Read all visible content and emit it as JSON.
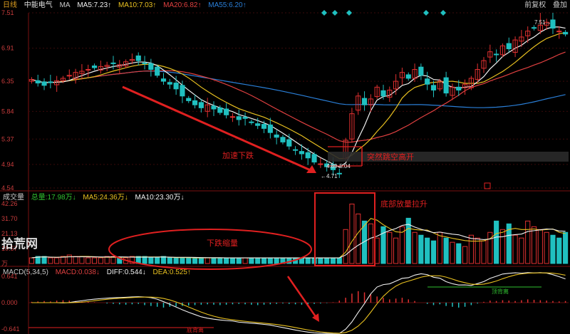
{
  "header": {
    "period": "日线",
    "stock": "中能电气",
    "ma_label": "MA",
    "ma5": "MA5:7.23↑",
    "ma10": "MA10:7.03↑",
    "ma20": "MA20:6.82↑",
    "ma55": "MA55:6.20↑",
    "adjust": "前复权",
    "overlay": "叠加"
  },
  "volume_header": {
    "title": "成交量",
    "total": "总量:17.98万↓",
    "ma5": "MA5:24.36万↓",
    "ma10": "MA10:23.30万↓"
  },
  "macd_header": {
    "title": "MACD(5,34,5)",
    "macd": "MACD:0.038↓",
    "diff": "DIFF:0.544↓",
    "dea": "DEA:0.525↑"
  },
  "watermark": "拾荒网",
  "colors": {
    "up": "#e03030",
    "down": "#20c0c0",
    "ma5": "#f0f0f0",
    "ma10": "#e8c020",
    "ma20": "#e04040",
    "ma55": "#2a7fd8",
    "annotation": "#e02020"
  },
  "annotations": {
    "accelerate_down": "加速下跌",
    "gap_up": "突然跳空高开",
    "volume_shrink": "下跌缩量",
    "volume_expand": "底部放量拉升",
    "price_low": "←4.71",
    "price_range": "4.89-5.04",
    "price_high": "7.51→",
    "macd_bottom_div": "底背离",
    "macd_top_div": "顶背离"
  },
  "chart_data": [
    {
      "type": "candlestick",
      "title": "日线 中能电气",
      "yticks": [
        "7.51",
        "6.91",
        "6.35",
        "5.84",
        "5.37",
        "4.94",
        "4.54"
      ],
      "ylim": [
        4.54,
        7.51
      ],
      "low": 4.71,
      "high": 7.51,
      "gap_range": [
        4.89,
        5.04
      ],
      "ma_last": {
        "MA5": 7.23,
        "MA10": 7.03,
        "MA20": 6.82,
        "MA55": 6.2
      },
      "close": [
        6.38,
        6.32,
        6.28,
        6.33,
        6.36,
        6.4,
        6.45,
        6.5,
        6.52,
        6.55,
        6.58,
        6.6,
        6.62,
        6.65,
        6.63,
        6.68,
        6.72,
        6.7,
        6.65,
        6.55,
        6.45,
        6.35,
        6.3,
        6.22,
        6.1,
        6.02,
        5.95,
        5.9,
        5.95,
        5.88,
        5.82,
        5.78,
        5.75,
        5.7,
        5.72,
        5.65,
        5.6,
        5.55,
        5.48,
        5.4,
        5.32,
        5.25,
        5.18,
        5.12,
        5.05,
        4.98,
        4.95,
        4.9,
        4.85,
        4.78,
        5.35,
        5.8,
        6.1,
        5.95,
        6.05,
        6.25,
        6.1,
        6.2,
        6.35,
        6.5,
        6.4,
        6.55,
        6.45,
        6.3,
        6.2,
        6.35,
        6.15,
        6.25,
        6.2,
        6.3,
        6.4,
        6.55,
        6.7,
        6.85,
        6.8,
        6.95,
        6.9,
        7.05,
        7.1,
        7.2,
        7.25,
        7.3,
        7.35,
        7.25,
        7.2,
        7.15
      ]
    },
    {
      "type": "bar",
      "title": "成交量",
      "unit": "万",
      "yticks": [
        "42.26",
        "31.70",
        "21.13",
        "10.57",
        "万"
      ],
      "ylim": [
        0,
        42.26
      ],
      "values": [
        4,
        5,
        5,
        4,
        4,
        5,
        6,
        5,
        5,
        4,
        4,
        4,
        5,
        5,
        4,
        4,
        5,
        5,
        5,
        4,
        4,
        5,
        4,
        4,
        4,
        4,
        4,
        4,
        4,
        4,
        4,
        4,
        4,
        4,
        4,
        4,
        4,
        4,
        4,
        4,
        4,
        4,
        4,
        4,
        4,
        4,
        4,
        4,
        4,
        4,
        24,
        42,
        35,
        30,
        28,
        18,
        26,
        22,
        18,
        26,
        32,
        22,
        20,
        18,
        16,
        22,
        18,
        15,
        14,
        12,
        20,
        18,
        16,
        22,
        30,
        24,
        28,
        20,
        18,
        30,
        26,
        24,
        22,
        20,
        18,
        22
      ]
    },
    {
      "type": "bar",
      "title": "MACD(5,34,5)",
      "yticks": [
        "0.641",
        "0.000",
        "-0.641"
      ],
      "ylim": [
        -0.641,
        0.641
      ],
      "values": [
        0.02,
        0.03,
        0.04,
        0.03,
        0.05,
        0.06,
        0.05,
        0.04,
        0.03,
        0.02,
        0.01,
        0.0,
        -0.02,
        -0.03,
        -0.04,
        -0.05,
        -0.04,
        -0.03,
        -0.06,
        -0.08,
        -0.1,
        -0.12,
        -0.1,
        -0.09,
        -0.08,
        -0.07,
        -0.06,
        -0.05,
        -0.04,
        -0.05,
        -0.06,
        -0.05,
        -0.04,
        -0.03,
        -0.04,
        -0.05,
        -0.06,
        -0.05,
        -0.04,
        -0.03,
        -0.02,
        -0.03,
        -0.04,
        -0.05,
        -0.04,
        -0.03,
        -0.02,
        -0.01,
        0.01,
        0.05,
        0.12,
        0.22,
        0.28,
        0.25,
        0.2,
        0.15,
        0.12,
        0.08,
        0.1,
        0.12,
        0.08,
        0.04,
        0.0,
        -0.03,
        -0.06,
        -0.04,
        -0.08,
        -0.1,
        -0.12,
        -0.1,
        -0.06,
        -0.02,
        0.02,
        0.05,
        0.04,
        0.06,
        0.05,
        0.04,
        0.06,
        0.08,
        0.07,
        0.06,
        0.05,
        0.04,
        0.03,
        0.04
      ]
    }
  ]
}
